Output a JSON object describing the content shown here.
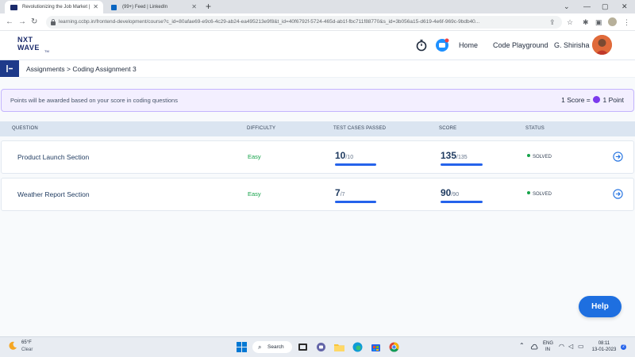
{
  "browser": {
    "tabs": [
      {
        "title": "Revolutionizing the Job Market |",
        "active": true
      },
      {
        "title": "(99+) Feed | LinkedIn",
        "active": false
      }
    ],
    "url": "learning.ccbp.in/frontend-development/course?c_id=80afae69-e9c6-4c29-ab24-ea495213e9f8&t_id=40f6792f-5724-465d-ab1f-fbc711f88770&s_id=3b056a15-d619-4e6f-969c-9bdb40..."
  },
  "header": {
    "logo_line1": "NXT",
    "logo_line2": "WAVE",
    "logo_tm": "TM",
    "home_label": "Home",
    "playground_label": "Code Playground",
    "user_name": "G. Shirisha"
  },
  "breadcrumb": {
    "text": "Assignments > Coding Assignment 3"
  },
  "banner": {
    "message": "Points will be awarded based on your score in coding questions",
    "score_left": "1 Score =",
    "score_right": "1 Point"
  },
  "table": {
    "headers": [
      "QUESTION",
      "DIFFICULTY",
      "TEST CASES PASSED",
      "SCORE",
      "STATUS"
    ],
    "rows": [
      {
        "question": "Product Launch Section",
        "difficulty": "Easy",
        "passed": "10",
        "total": "/10",
        "score": "135",
        "max": "/135",
        "status": "SOLVED"
      },
      {
        "question": "Weather Report Section",
        "difficulty": "Easy",
        "passed": "7",
        "total": "/7",
        "score": "90",
        "max": "/90",
        "status": "SOLVED"
      }
    ]
  },
  "help_label": "Help",
  "taskbar": {
    "temp": "65°F",
    "condition": "Clear",
    "search_label": "Search",
    "lang1": "ENG",
    "lang2": "IN",
    "time": "08:11",
    "date": "13-01-2023",
    "notifications": "2"
  },
  "colors": {
    "brand": "#1b2b6b",
    "accent": "#1e6fe0",
    "easy": "#16a34a",
    "banner_border": "#c4b5fd"
  }
}
